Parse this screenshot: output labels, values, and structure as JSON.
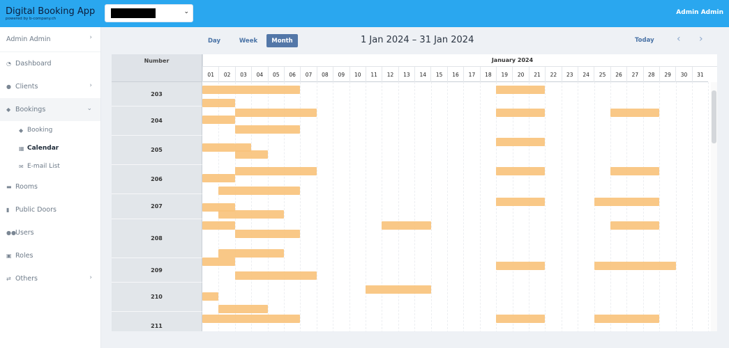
{
  "app": {
    "title": "Digital Booking App",
    "subtitle": "powered by b-company.ch",
    "user": "Admin Admin"
  },
  "select": {
    "chevron": "⌄"
  },
  "sidebar": {
    "user_label": "Admin Admin",
    "items": [
      {
        "label": "Dashboard",
        "icon": "clock-icon"
      },
      {
        "label": "Clients",
        "icon": "user-icon"
      },
      {
        "label": "Bookings",
        "icon": "tag-icon"
      },
      {
        "label": "Rooms",
        "icon": "bed-icon"
      },
      {
        "label": "Public Doors",
        "icon": "door-icon"
      },
      {
        "label": "Users",
        "icon": "users-icon"
      },
      {
        "label": "Roles",
        "icon": "lock-icon"
      },
      {
        "label": "Others",
        "icon": "exchange-icon"
      }
    ],
    "sub_items": [
      {
        "label": "Booking",
        "icon": "tag-icon"
      },
      {
        "label": "Calendar",
        "icon": "calendar-icon"
      },
      {
        "label": "E-mail List",
        "icon": "envelope-icon"
      }
    ]
  },
  "calendar": {
    "views": [
      "Day",
      "Week",
      "Month"
    ],
    "active_view": "Month",
    "range": "1 Jan 2024 – 31 Jan 2024",
    "today_label": "Today",
    "month_label": "January 2024",
    "number_header": "Number",
    "days": [
      "01",
      "02",
      "03",
      "04",
      "05",
      "06",
      "07",
      "08",
      "09",
      "10",
      "11",
      "12",
      "13",
      "14",
      "15",
      "16",
      "17",
      "18",
      "19",
      "20",
      "21",
      "22",
      "23",
      "24",
      "25",
      "26",
      "27",
      "28",
      "29",
      "30",
      "31"
    ],
    "rooms": [
      "203",
      "204",
      "205",
      "206",
      "207",
      "208",
      "209",
      "210",
      "211"
    ],
    "booking_color": "#f8c27a"
  },
  "colors": {
    "topbar": "#2aa7ef",
    "active_view": "#5377a8"
  }
}
